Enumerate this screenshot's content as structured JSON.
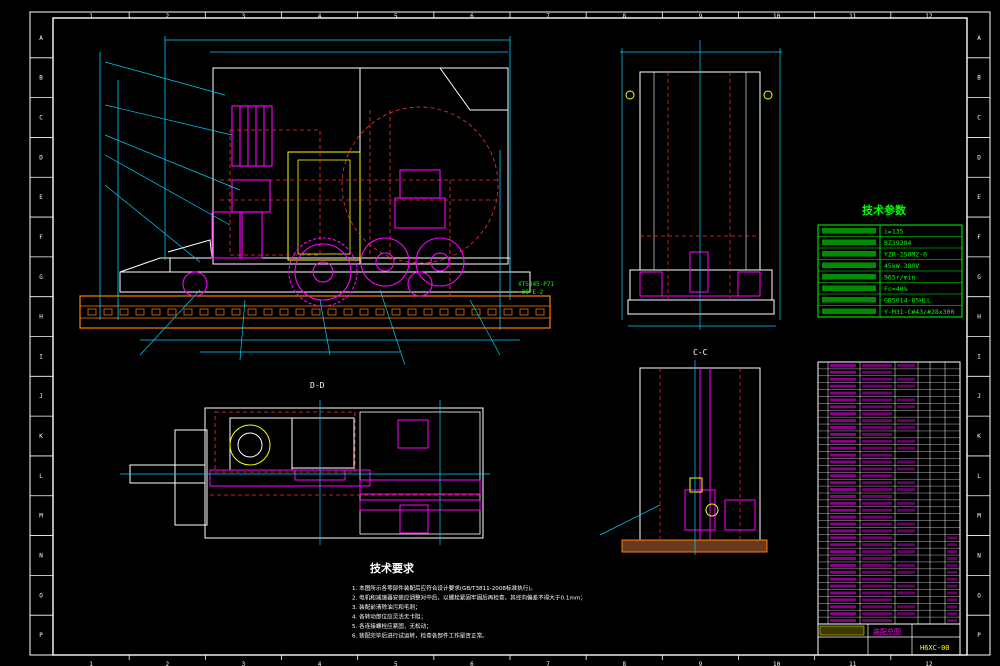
{
  "border": {
    "columns": [
      "1",
      "2",
      "3",
      "4",
      "5",
      "6",
      "7",
      "8",
      "9",
      "10",
      "11",
      "12"
    ],
    "rows": [
      "A",
      "B",
      "C",
      "D",
      "E",
      "F",
      "G",
      "H",
      "I",
      "J",
      "K",
      "L",
      "M",
      "N",
      "O",
      "P"
    ]
  },
  "views": {
    "section_dd": "D-D",
    "section_cc": "C-C"
  },
  "elevation_note": [
    "XTS345-P71",
    "-30°E-2"
  ],
  "tech_params": {
    "title": "技术参数",
    "values": [
      "i=135",
      "BZ39384",
      "YZR-250M2-6",
      "45kW 380V",
      "965r/min",
      "Fc=40%",
      "GB5014-85HLL",
      "Y-M31-C#43/#28x300"
    ]
  },
  "tech_requirements": {
    "title": "技术要求",
    "items": [
      "1. 本图所示各零部件装配后应符合设计要求(GB/T3811-2008标准执行)。",
      "2. 电机和减速器安装应调整对中后，以螺栓紧固牢固后再检查，其径向偏差不得大于0.1mm；",
      "3. 装配前清除油污和毛刺；",
      "4. 各转动部位应灵活无卡阻；",
      "5. 各连接螺栓应紧固，无松动；",
      "6. 装配完毕后进行试运转，检查各部件工作是否正常。"
    ]
  },
  "title_block": {
    "drawing_no": "H6XC-00",
    "name": "装配总图"
  }
}
